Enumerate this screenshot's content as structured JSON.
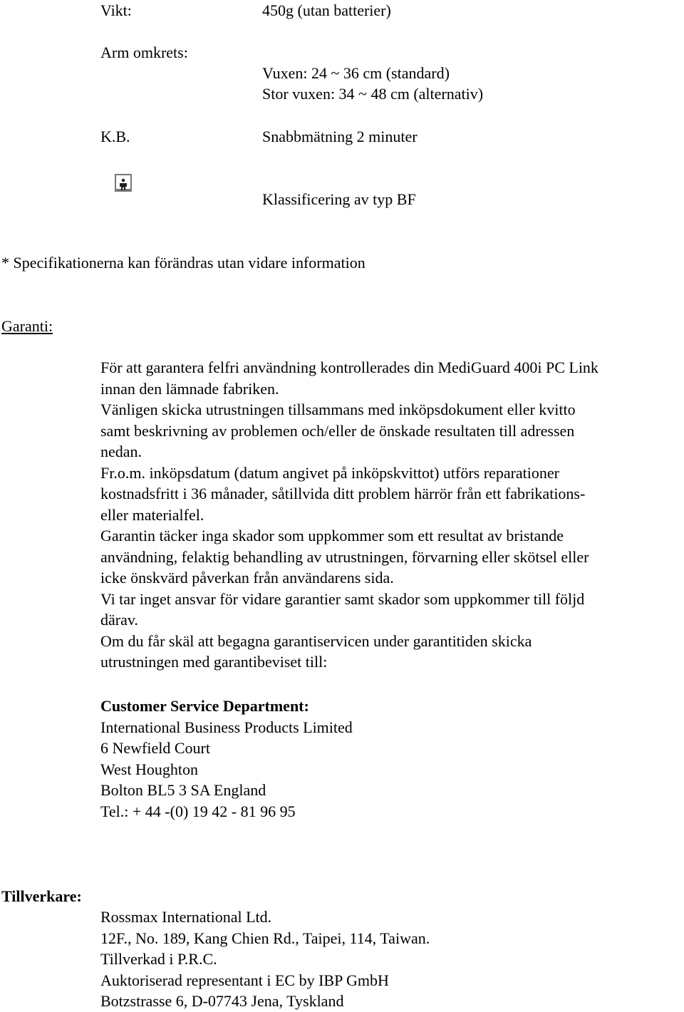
{
  "specs": [
    {
      "label": "Vikt:",
      "values": [
        "450g (utan batterier)"
      ]
    },
    {
      "label": "Arm omkrets:",
      "values": [
        "Vuxen: 24 ~ 36 cm (standard)",
        "Stor vuxen: 34 ~ 48 cm (alternativ)"
      ]
    },
    {
      "label": "K.B.",
      "values": [
        "Snabbmätning 2 minuter"
      ]
    },
    {
      "icon": "type-bf-applied-part-icon",
      "values": [
        "Klassificering av typ BF"
      ]
    }
  ],
  "note": "* Specifikationerna kan förändras utan vidare information",
  "warranty": {
    "heading": "Garanti:",
    "lines": [
      "För att garantera felfri användning kontrollerades din MediGuard 400i PC Link",
      "innan den lämnade fabriken.",
      "Vänligen skicka utrustningen tillsammans med inköpsdokument eller kvitto",
      "samt beskrivning av problemen och/eller de önskade resultaten till adressen",
      "nedan.",
      "Fr.o.m. inköpsdatum (datum angivet på inköpskvittot) utförs reparationer",
      "kostnadsfritt i 36 månader, såtillvida ditt problem härrör från ett fabrikations-",
      "eller materialfel.",
      "Garantin täcker inga skador som uppkommer som ett resultat av bristande",
      "användning, felaktig behandling av utrustningen, förvarning eller skötsel eller",
      "icke önskvärd påverkan från användarens sida.",
      "Vi tar inget ansvar för vidare garantier samt skador som uppkommer till följd",
      "därav.",
      "Om du får skäl att begagna garantiservicen under garantitiden skicka",
      "utrustningen med garantibeviset till:"
    ]
  },
  "service": {
    "heading": "Customer Service Department:",
    "lines": [
      "International Business Products Limited",
      "6 Newfield Court",
      "West Houghton",
      "Bolton BL5 3 SA England",
      "Tel.: + 44 -(0) 19 42 - 81 96 95"
    ]
  },
  "manufacturer": {
    "heading": "Tillverkare:",
    "lines": [
      "Rossmax International Ltd.",
      "12F., No. 189, Kang Chien Rd., Taipei, 114, Taiwan.",
      "Tillverkad i P.R.C.",
      "Auktoriserad representant i EC by IBP GmbH",
      "Botzstrasse 6, D-07743 Jena, Tyskland"
    ]
  }
}
